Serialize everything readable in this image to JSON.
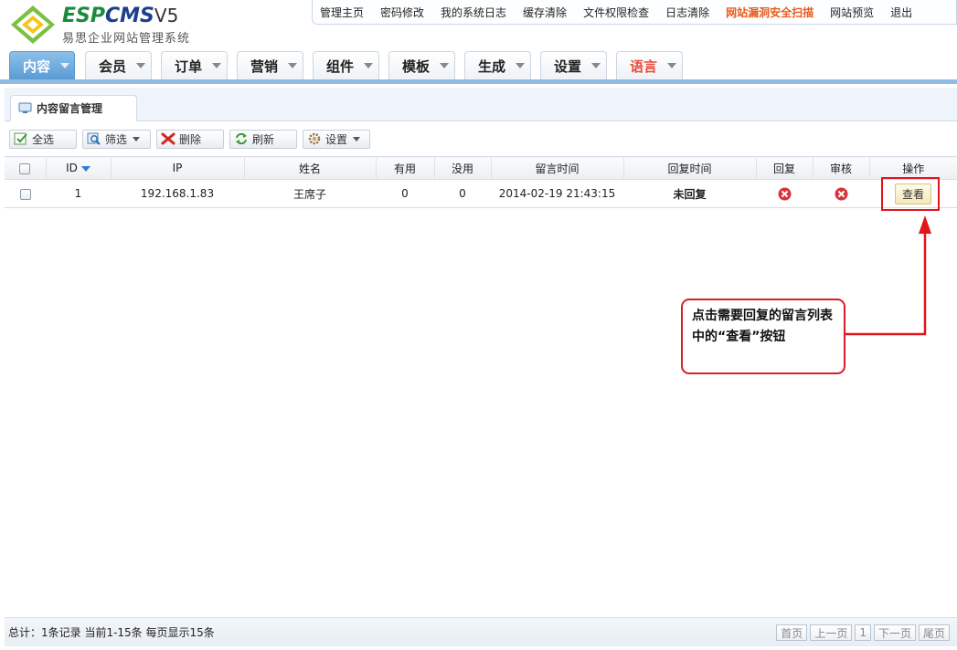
{
  "brand": {
    "name_a": "ESP",
    "name_b": "CMS",
    "version": "V5",
    "subtitle": "易思企业网站管理系统"
  },
  "topnav": [
    "管理主页",
    "密码修改",
    "我的系统日志",
    "缓存清除",
    "文件权限检查",
    "日志清除",
    "网站漏洞安全扫描",
    "网站预览",
    "退出"
  ],
  "mainmenu": [
    "内容",
    "会员",
    "订单",
    "营销",
    "组件",
    "模板",
    "生成",
    "设置",
    "语言"
  ],
  "page_tab": "内容留言管理",
  "toolbar": {
    "select_all": "全选",
    "filter": "筛选",
    "delete": "删除",
    "refresh": "刷新",
    "settings": "设置"
  },
  "table": {
    "headers": [
      "ID",
      "IP",
      "姓名",
      "有用",
      "没用",
      "留言时间",
      "回复时间",
      "回复",
      "审核",
      "操作"
    ],
    "rows": [
      {
        "id": "1",
        "ip": "192.168.1.83",
        "name": "王席子",
        "useful": "0",
        "useless": "0",
        "time": "2014-02-19 21:43:15",
        "reply_time": "未回复",
        "action": "查看"
      }
    ]
  },
  "annotation": "点击需要回复的留言列表中的“查看”按钮",
  "footer": {
    "summary": "总计：1条记录 当前1-15条 每页显示15条",
    "pager": [
      "首页",
      "上一页",
      "1",
      "下一页",
      "尾页"
    ]
  },
  "colors": {
    "accent": "#5a9bd4",
    "warn": "#e85a1c",
    "error": "#c4161c",
    "annotation": "#e3141a"
  }
}
